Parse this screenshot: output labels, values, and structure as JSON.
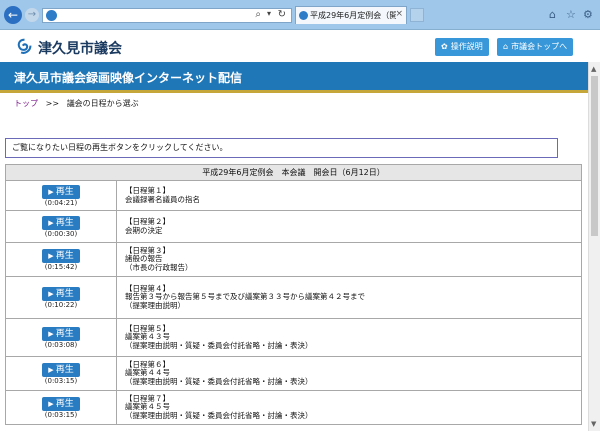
{
  "browser": {
    "tab_title": "平成29年6月定例会（開会...",
    "tab_close": "×",
    "addr_search": "⌕",
    "addr_drop": "▾",
    "addr_refresh": "↻"
  },
  "site": {
    "logo_text": "津久見市議会",
    "btn_manual": "操作説明",
    "btn_top": "市議会トップへ",
    "banner": "津久見市議会録画映像インターネット配信"
  },
  "breadcrumb": {
    "top": "トップ",
    "sep": ">>",
    "current": "議会の日程から選ぶ"
  },
  "instruction": "ご覧になりたい日程の再生ボタンをクリックしてください。",
  "table": {
    "header": "平成29年6月定例会　本会議　開会日（6月12日）",
    "play_label": "再生",
    "rows": [
      {
        "duration": "(0:04:21)",
        "text": "【日程第１】\n会議録署名議員の指名"
      },
      {
        "duration": "(0:00:30)",
        "text": "【日程第２】\n会期の決定"
      },
      {
        "duration": "(0:15:42)",
        "text": "【日程第３】\n諸般の報告\n（市長の行政報告）"
      },
      {
        "duration": "(0:10:22)",
        "text": "【日程第４】\n報告第３号から報告第５号まで及び議案第３３号から議案第４２号まで\n（提案理由説明）"
      },
      {
        "duration": "(0:03:08)",
        "text": "【日程第５】\n議案第４３号\n（提案理由説明・質疑・委員会付託省略・討論・表決）"
      },
      {
        "duration": "(0:03:15)",
        "text": "【日程第６】\n議案第４４号\n（提案理由説明・質疑・委員会付託省略・討論・表決）"
      },
      {
        "duration": "(0:03:15)",
        "text": "【日程第７】\n議案第４５号\n（提案理由説明・質疑・委員会付託省略・討論・表決）"
      }
    ]
  }
}
